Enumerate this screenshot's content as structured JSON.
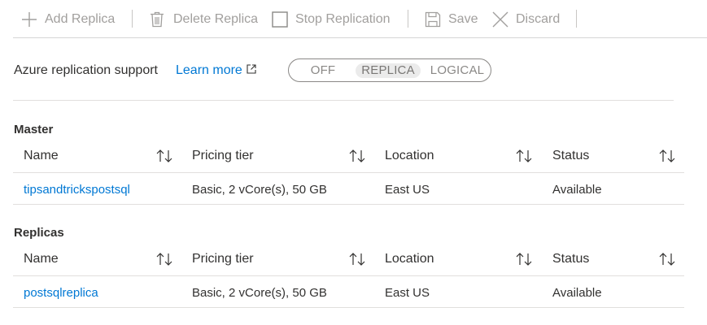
{
  "toolbar": {
    "items": [
      {
        "label": "Add Replica",
        "icon": "plus-icon"
      },
      {
        "label": "Delete Replica",
        "icon": "trash-icon"
      },
      {
        "label": "Stop Replication",
        "icon": "square-icon"
      },
      {
        "label": "Save",
        "icon": "save-icon"
      },
      {
        "label": "Discard",
        "icon": "close-icon"
      }
    ],
    "disabled_color": "#a19f9d"
  },
  "replication": {
    "label": "Azure replication support",
    "learn_more": "Learn more",
    "options": [
      "OFF",
      "REPLICA",
      "LOGICAL"
    ],
    "selected": "REPLICA"
  },
  "tables": {
    "columns": [
      "Name",
      "Pricing tier",
      "Location",
      "Status"
    ],
    "master": {
      "title": "Master",
      "rows": [
        {
          "name": "tipsandtrickspostsql",
          "tier": "Basic, 2 vCore(s), 50 GB",
          "location": "East US",
          "status": "Available"
        }
      ]
    },
    "replicas": {
      "title": "Replicas",
      "rows": [
        {
          "name": "postsqlreplica",
          "tier": "Basic, 2 vCore(s), 50 GB",
          "location": "East US",
          "status": "Available"
        }
      ]
    }
  },
  "colors": {
    "link": "#0078d4",
    "text": "#323130",
    "border": "#e1dfdd"
  }
}
